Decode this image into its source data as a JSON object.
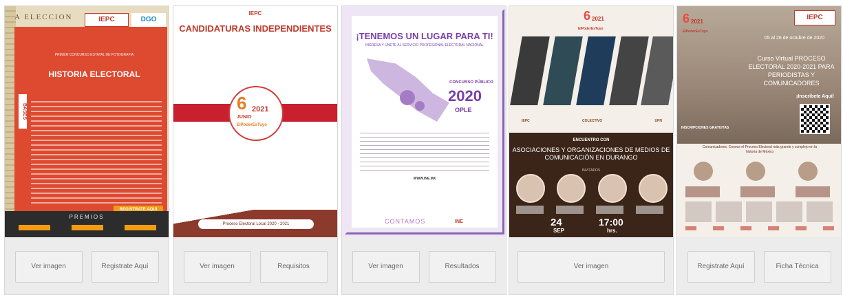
{
  "cards": [
    {
      "poster": {
        "top_text": "A ELECCION",
        "logo": "IEPC",
        "logo2": "DGO",
        "subtitle": "PRIMER CONCURSO ESTATAL DE FOTOGRAFIA",
        "title": "HISTORIA ELECTORAL",
        "bases": "BASES",
        "register": "REGISTRATE AQUI",
        "prizes": "PREMIOS"
      },
      "buttons": [
        "Ver imagen",
        "Registrate Aquí"
      ]
    },
    {
      "poster": {
        "logo": "IEPC",
        "title": "CANDIDATURAS INDEPENDIENTES",
        "day": "6",
        "year": "2021",
        "month": "JUNIO",
        "hashtag": "ElPoderEsTuyo",
        "footer": "Proceso Electoral Local 2020 - 2021"
      },
      "buttons": [
        "Ver imagen",
        "Requisitos"
      ]
    },
    {
      "poster": {
        "title": "¡TENEMOS UN LUGAR PARA TI!",
        "subtitle": "INGRESA Y ÚNETE AL SERVICIO PROFESIONAL ELECTORAL NACIONAL",
        "contest": "CONCURSO PÚBLICO",
        "year": "2020",
        "ople": "OPLE",
        "url": "WWW.INE.MX",
        "footer": "CONTAMOS",
        "brand": "INE"
      },
      "buttons": [
        "Ver imagen",
        "Resultados"
      ]
    },
    {
      "poster": {
        "day": "6",
        "year": "2021",
        "hashtag": "ElPoderEsTuyo",
        "logos": [
          "IEPC",
          "COLECTIVO",
          "UPN"
        ],
        "meeting": "ENCUENTRO CON",
        "title": "ASOCIACIONES Y ORGANIZACIONES DE MEDIOS DE COMUNICACIÓN EN DURANGO",
        "invited": "INVITADOS",
        "date": "24",
        "month": "SEP",
        "time": "17:00",
        "hours": "hrs."
      },
      "buttons": [
        "Ver imagen"
      ]
    },
    {
      "poster": {
        "day": "6",
        "year": "2021",
        "hashtag": "ElPoderEsTuyo",
        "logo": "IEPC",
        "dates": "05 al 26 de octubre de 2020",
        "title": "Curso Virtual PROCESO ELECTORAL 2020-2021 PARA PERIODISTAS Y COMUNICADORES",
        "register": "¡Inscríbete Aquí!",
        "enrollment": "INSCRIPCIONES GRATUITAS",
        "summary": "Comunicadores: Conoce el Proceso Electoral más grande y complejo en la historia de México"
      },
      "buttons": [
        "Registrate Aquí",
        "Ficha Técnica"
      ]
    }
  ]
}
